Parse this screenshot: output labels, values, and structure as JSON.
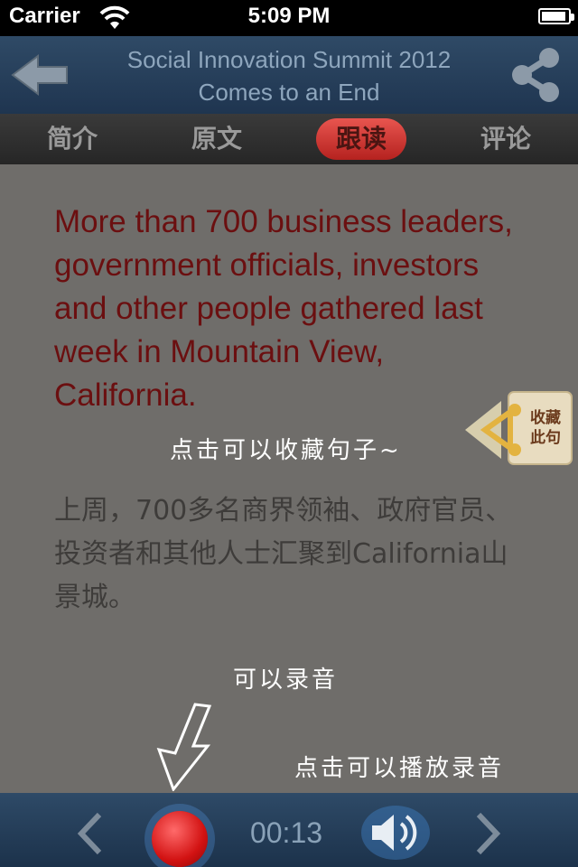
{
  "status_bar": {
    "carrier": "Carrier",
    "time": "5:09 PM"
  },
  "nav": {
    "title_line1": "Social Innovation Summit 2012",
    "title_line2": "Comes to an End"
  },
  "tabs": [
    {
      "label": "简介"
    },
    {
      "label": "原文"
    },
    {
      "label": "跟读"
    },
    {
      "label": "评论"
    }
  ],
  "content": {
    "english": "More than 700 business leaders, government officials, investors and other people gathered last week in Mountain View, California.",
    "chinese": "上周，700多名商界领袖、政府官员、投资者和其他人士汇聚到California山景城。",
    "hint_collect": "点击可以收藏句子~",
    "hint_record": "可以录音",
    "hint_play": "点击可以播放录音",
    "collect_button": {
      "line1": "收藏",
      "line2": "此句"
    }
  },
  "toolbar": {
    "timer": "00:13"
  },
  "colors": {
    "english_text": "#6b0f10",
    "nav_bg": "#2f4a66",
    "record": "#d21212"
  }
}
